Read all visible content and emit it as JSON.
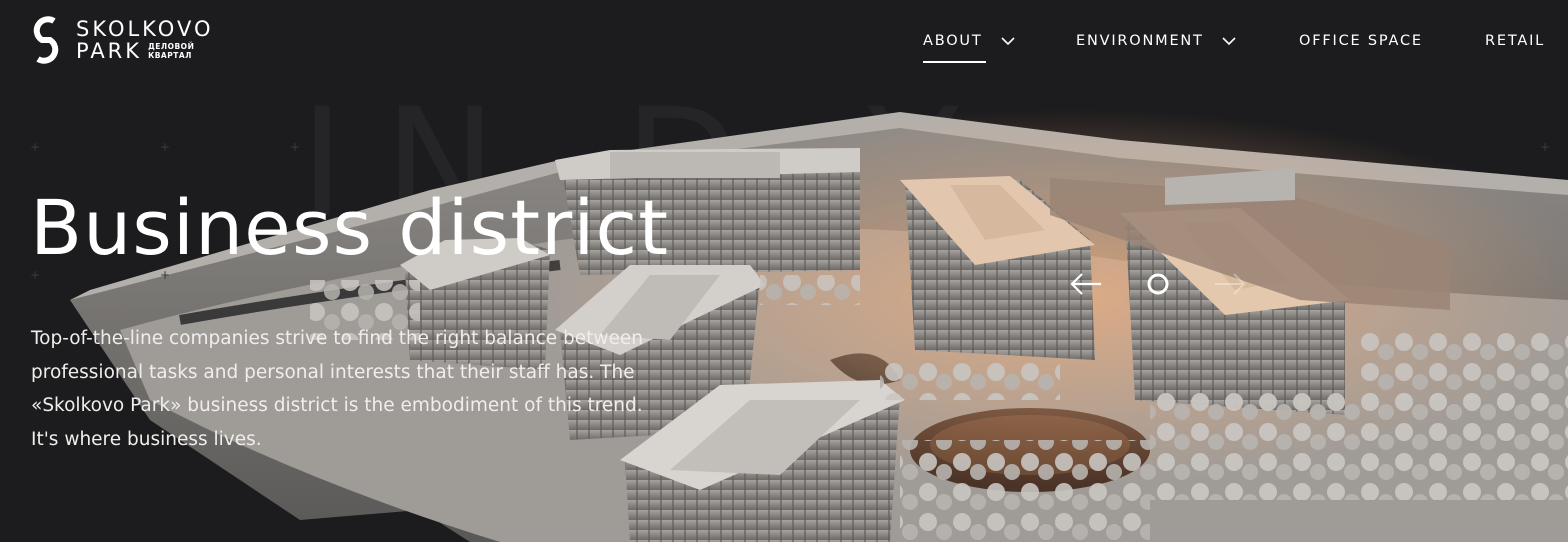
{
  "logo": {
    "line1": "SKOLKOVO",
    "line2": "PARK",
    "sub_line1": "ДЕЛОВОЙ",
    "sub_line2": "КВАРТАЛ"
  },
  "nav": {
    "items": [
      {
        "label": "ABOUT",
        "has_dropdown": true,
        "active": true
      },
      {
        "label": "ENVIRONMENT",
        "has_dropdown": true,
        "active": false
      },
      {
        "label": "OFFICE SPACE",
        "has_dropdown": false,
        "active": false
      },
      {
        "label": "RETAIL",
        "has_dropdown": false,
        "active": false
      }
    ]
  },
  "hero": {
    "title": "Business district",
    "description": "Top-of-the-line companies strive to find the right balance between professional tasks and personal interests that their staff has. The «Skolkovo Park» business district is the embodiment of this trend. It's where business lives."
  },
  "slider": {
    "prev_icon": "arrow-left-icon",
    "next_icon": "arrow-right-icon",
    "indicator_icon": "slide-dot-icon"
  },
  "colors": {
    "background": "#1c1b1d",
    "text": "#ffffff",
    "model_light": "#bdb8b3",
    "model_warm": "#e0a477"
  }
}
